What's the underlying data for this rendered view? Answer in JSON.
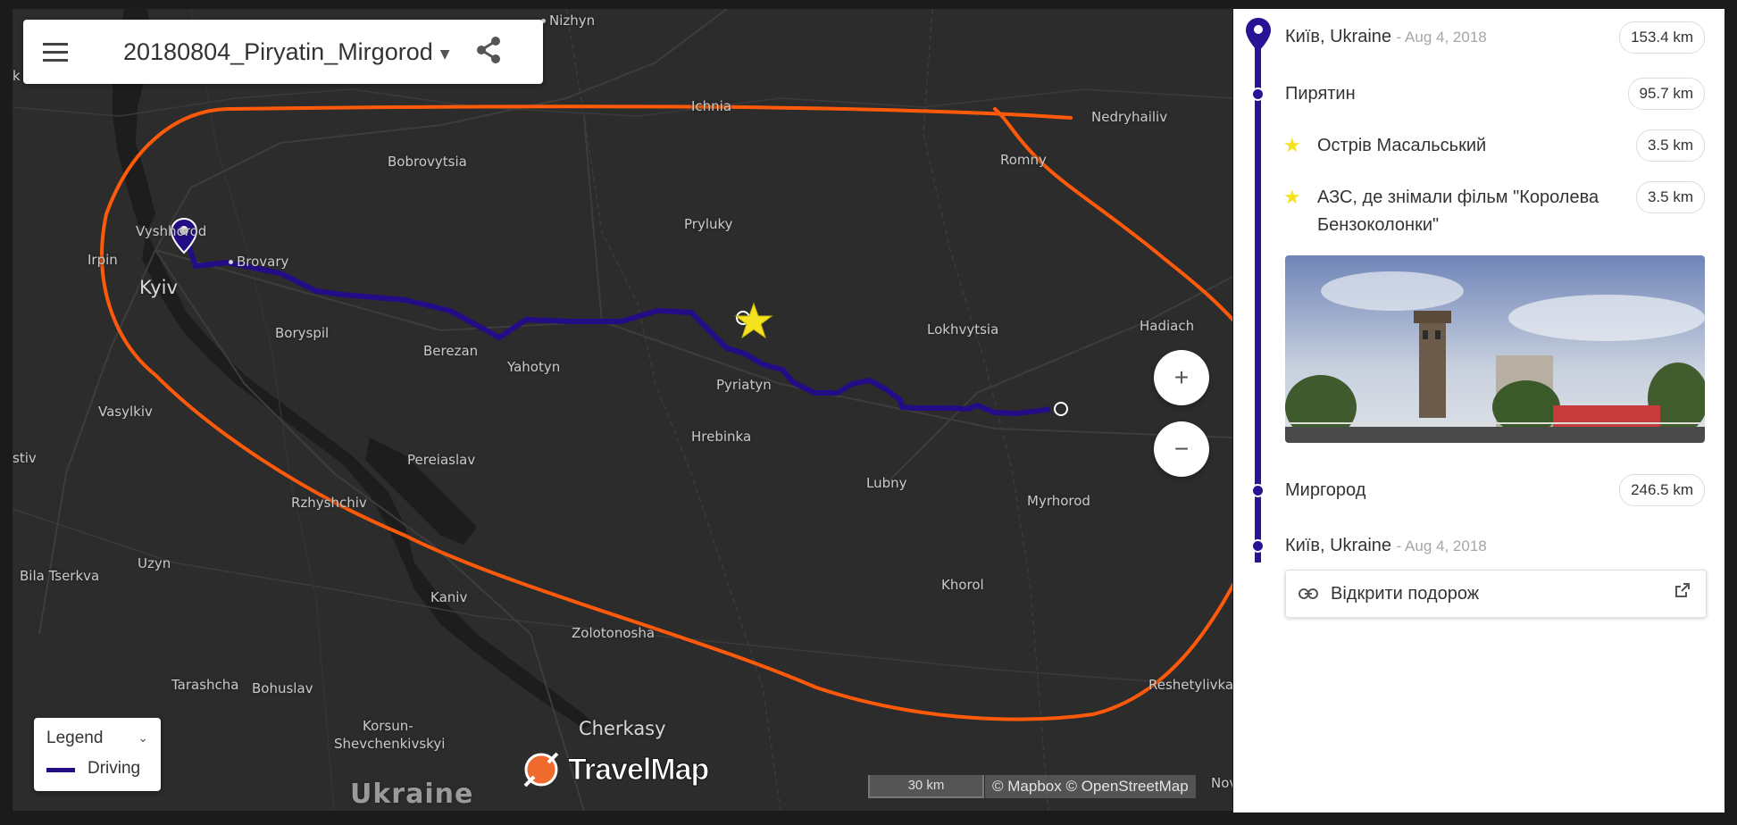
{
  "trip": {
    "title": "20180804_Piryatin_Mirgorod"
  },
  "map": {
    "cities": [
      {
        "name": "Nizhyn"
      },
      {
        "name": "Ichnia"
      },
      {
        "name": "Nedryhailiv"
      },
      {
        "name": "Bobrovytsia"
      },
      {
        "name": "Romny"
      },
      {
        "name": "Vyshhorod"
      },
      {
        "name": "Pryluky"
      },
      {
        "name": "Irpin"
      },
      {
        "name": "Brovary"
      },
      {
        "name": "Kyiv"
      },
      {
        "name": "Hadiach"
      },
      {
        "name": "Boryspil"
      },
      {
        "name": "Lokhvytsia"
      },
      {
        "name": "Berezan"
      },
      {
        "name": "Yahotyn"
      },
      {
        "name": "Pyriatyn"
      },
      {
        "name": "Vasylkiv"
      },
      {
        "name": "Hrebinka"
      },
      {
        "name": "Pereiaslav"
      },
      {
        "name": "Lubny"
      },
      {
        "name": "Myrhorod"
      },
      {
        "name": "Rzhyshchiv"
      },
      {
        "name": "Bila Tserkva"
      },
      {
        "name": "Uzyn"
      },
      {
        "name": "Khorol"
      },
      {
        "name": "Kaniv"
      },
      {
        "name": "Zolotonosha"
      },
      {
        "name": "Tarashcha"
      },
      {
        "name": "Bohuslav"
      },
      {
        "name": "Reshetylivka"
      },
      {
        "name": "Cherkasy"
      },
      {
        "name": "Korsun-"
      },
      {
        "name": "Shevchenkivskyi"
      },
      {
        "name": "Ukraine"
      },
      {
        "name": "stiv"
      },
      {
        "name": "k"
      },
      {
        "name": "Nov"
      }
    ],
    "zoom_in": "+",
    "zoom_out": "−",
    "scale": "30 km",
    "attribution": "© Mapbox © OpenStreetMap",
    "route_color": "#230c86",
    "annotation_color": "#ff5a0a"
  },
  "legend": {
    "title": "Legend",
    "item": "Driving"
  },
  "brand": {
    "name": "TravelMap"
  },
  "panel": {
    "stops": [
      {
        "name": "Київ, Ukraine",
        "date": "- Aug 4, 2018",
        "distance": "153.4 km"
      },
      {
        "name": "Пирятин",
        "distance": "95.7 km"
      },
      {
        "name": "Острів Масальський",
        "distance": "3.5 km"
      },
      {
        "name": "АЗС, де знімали фільм \"Королева",
        "name2": "Бензоколонки\"",
        "distance": "3.5 km"
      },
      {
        "name": "Миргород",
        "distance": "246.5 km"
      },
      {
        "name": "Київ, Ukraine",
        "date": "- Aug 4, 2018"
      }
    ],
    "open_trip": "Відкрити подорож"
  }
}
